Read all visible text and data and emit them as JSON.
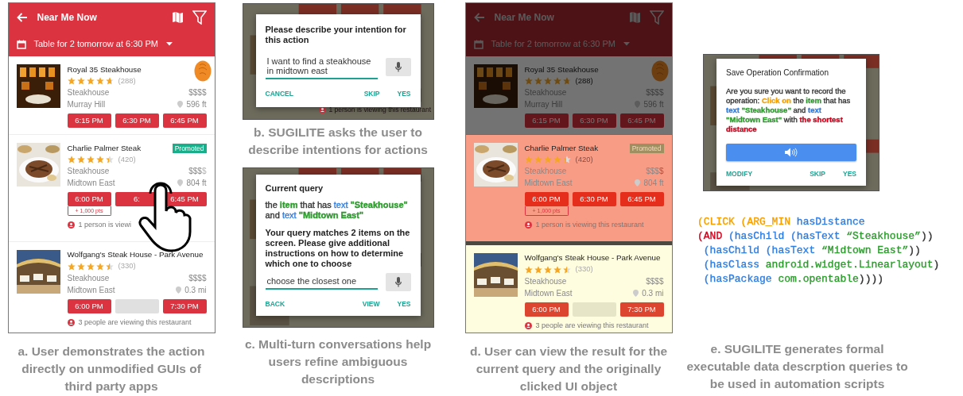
{
  "figure_a": {
    "app": {
      "header": {
        "title": "Near Me Now",
        "subtitle": "Table for 2 tomorrow at 6:30 PM",
        "dimmed": false
      },
      "touch_marker": true,
      "hand_pointer": true,
      "restaurants": [
        {
          "kind": "plain",
          "name": "Royal 35 Steakhouse",
          "stars": 4.7,
          "reviews": "(288)",
          "cuisine": "Steakhouse",
          "price": "$$$$",
          "neighborhood": "Murray Hill",
          "distance": "596 ft",
          "times": [
            {
              "kind": "slot",
              "label": "6:15 PM"
            },
            {
              "kind": "slot",
              "label": "6:30 PM"
            },
            {
              "kind": "slot",
              "label": "6:45 PM"
            }
          ]
        },
        {
          "kind": "plain",
          "name": "Charlie Palmer Steak",
          "badge": "Promoted",
          "stars": 4.4,
          "reviews": "(420)",
          "cuisine": "Steakhouse",
          "price": "$$$",
          "price_dim": "$",
          "neighborhood": "Midtown East",
          "distance": "804 ft",
          "times": [
            {
              "kind": "slot",
              "label": "6:00 PM",
              "points": "+ 1,000 pts"
            },
            {
              "kind": "slot",
              "label": "6:"
            },
            {
              "kind": "slot",
              "label": "6:45 PM"
            }
          ],
          "viewers": "1 person is viewi"
        },
        {
          "kind": "plain",
          "name": "Wolfgang's Steak House - Park Avenue",
          "stars": 4.5,
          "reviews": "(330)",
          "cuisine": "Steakhouse",
          "price": "$$$$",
          "neighborhood": "Midtown East",
          "distance": "0.3 mi",
          "times": [
            {
              "kind": "slot",
              "label": "6:00 PM"
            },
            {
              "kind": "empty"
            },
            {
              "kind": "slot",
              "label": "7:30 PM"
            }
          ],
          "viewers": "3 people are viewing this restaurant"
        }
      ]
    },
    "caption": "a. User demonstrates the action directly on unmodified GUIs of third party apps"
  },
  "figure_b": {
    "dialog": {
      "title": "Please describe your intention for this action",
      "input": "I want to find a steakhouse in midtown east",
      "actions": [
        "CANCEL",
        "SKIP",
        "YES"
      ]
    },
    "background_text": "1 person is viewing this restaurant",
    "caption": "b. **SUGILITE** asks the user to describe intentions for actions"
  },
  "figure_c": {
    "dialog": {
      "title": "Current query",
      "query": [
        {
          "text": "the ",
          "color": "#333333",
          "bold": false
        },
        {
          "text": "item",
          "color": "#2e9a2e",
          "bold": true
        },
        {
          "text": " that has ",
          "color": "#333333",
          "bold": false
        },
        {
          "text": "text",
          "color": "#2f7de1",
          "bold": false
        },
        {
          "text": " \"Steakhouse\"",
          "color": "#2e9a2e",
          "bold": true
        },
        {
          "text": " and ",
          "color": "#333333",
          "bold": false
        },
        {
          "text": "text",
          "color": "#2f7de1",
          "bold": false
        },
        {
          "text": " \"Midtown East\"",
          "color": "#2e9a2e",
          "bold": true
        }
      ],
      "message": "Your query matches 2 items on the screen. Please give additional instructions on how to determine which one to choose",
      "input": "choose the closest one",
      "actions": [
        "BACK",
        "VIEW",
        "YES"
      ]
    },
    "caption": "c. Multi-turn conversations help users refine ambiguous descriptions"
  },
  "figure_d": {
    "app": {
      "header": {
        "title": "Near Me Now",
        "subtitle": "Table for 2 tomorrow at 6:30 PM",
        "dimmed": true
      },
      "touch_marker": true,
      "hand_pointer": false,
      "restaurants": [
        {
          "kind": "dimmed",
          "name": "Royal 35 Steakhouse",
          "stars": 4.7,
          "reviews": "(288)",
          "cuisine": "Steakhouse",
          "price": "$$$$",
          "neighborhood": "Murray Hill",
          "distance": "596 ft",
          "times": [
            {
              "kind": "slot",
              "label": "6:15 PM"
            },
            {
              "kind": "slot",
              "label": "6:30 PM"
            },
            {
              "kind": "slot",
              "label": "6:45 PM"
            }
          ]
        },
        {
          "kind": "clicked",
          "name": "Charlie Palmer Steak",
          "badge": "Promoted",
          "stars": 4.4,
          "reviews": "(420)",
          "cuisine": "Steakhouse",
          "price": "$$$",
          "price_dim": "$",
          "neighborhood": "Midtown East",
          "distance": "804 ft",
          "times": [
            {
              "kind": "slot",
              "label": "6:00 PM",
              "points": "+ 1,000 pts"
            },
            {
              "kind": "slot",
              "label": "6:30 PM"
            },
            {
              "kind": "slot",
              "label": "6:45 PM"
            }
          ],
          "viewers": "1 person is viewing this restaurant"
        },
        {
          "kind": "result",
          "name": "Wolfgang's Steak House - Park Avenue",
          "stars": 4.5,
          "reviews": "(330)",
          "cuisine": "Steakhouse",
          "price": "$$$$",
          "neighborhood": "Midtown East",
          "distance": "0.3 mi",
          "times": [
            {
              "kind": "slot",
              "label": "6:00 PM"
            },
            {
              "kind": "empty"
            },
            {
              "kind": "slot",
              "label": "7:30 PM"
            }
          ],
          "viewers": "3 people are viewing this restaurant"
        }
      ]
    },
    "caption": "d. User can view the result for the current query and the originally clicked UI object"
  },
  "figure_e": {
    "dialog": {
      "title": "Save Operation Confirmation",
      "message": [
        {
          "text": "Are you sure you want to record the operation: ",
          "color": "#333333",
          "bold": false
        },
        {
          "text": "Click on",
          "color": "#f5a000",
          "bold": true
        },
        {
          "text": " the ",
          "color": "#333333",
          "bold": false
        },
        {
          "text": "item",
          "color": "#2e9a2e",
          "bold": true
        },
        {
          "text": " that has ",
          "color": "#333333",
          "bold": false
        },
        {
          "text": "text",
          "color": "#2f7de1",
          "bold": true
        },
        {
          "text": " \"Steakhouse\"",
          "color": "#2e9a2e",
          "bold": true
        },
        {
          "text": " and ",
          "color": "#333333",
          "bold": false
        },
        {
          "text": "text",
          "color": "#2f7de1",
          "bold": true
        },
        {
          "text": " \"Midtown East\"",
          "color": "#2e9a2e",
          "bold": true
        },
        {
          "text": " with ",
          "color": "#333333",
          "bold": false
        },
        {
          "text": "the shortest distance",
          "color": "#d0021b",
          "bold": true
        }
      ],
      "actions": [
        "MODIFY",
        "SKIP",
        "YES"
      ]
    },
    "code": [
      [
        {
          "text": "(CLICK",
          "color": "#f5a000"
        },
        {
          "text": " (ARG_MIN",
          "color": "#f5a000"
        },
        {
          "text": " hasDistance",
          "color": "#2f7de1"
        }
      ],
      [
        {
          "text": "(AND",
          "color": "#d0021b"
        },
        {
          "text": " (hasChild (hasText",
          "color": "#2f7de1"
        },
        {
          "text": " “Steakhouse”",
          "color": "#2e9a2e"
        },
        {
          "text": "))",
          "color": "#333333"
        }
      ],
      [
        {
          "text": " (hasChild (hasText",
          "color": "#2f7de1"
        },
        {
          "text": " “Midtown East”",
          "color": "#2e9a2e"
        },
        {
          "text": "))",
          "color": "#333333"
        }
      ],
      [
        {
          "text": " (hasClass",
          "color": "#2f7de1"
        },
        {
          "text": " android.widget.Linearlayout",
          "color": "#2e9a2e"
        },
        {
          "text": ")",
          "color": "#333333"
        }
      ],
      [
        {
          "text": " (hasPackage",
          "color": "#2f7de1"
        },
        {
          "text": " com.opentable",
          "color": "#2e9a2e"
        },
        {
          "text": "))))",
          "color": "#333333"
        }
      ]
    ],
    "caption": "e. **SUGILITE** generates formal executable data descrption queries to be used in automation scripts"
  }
}
